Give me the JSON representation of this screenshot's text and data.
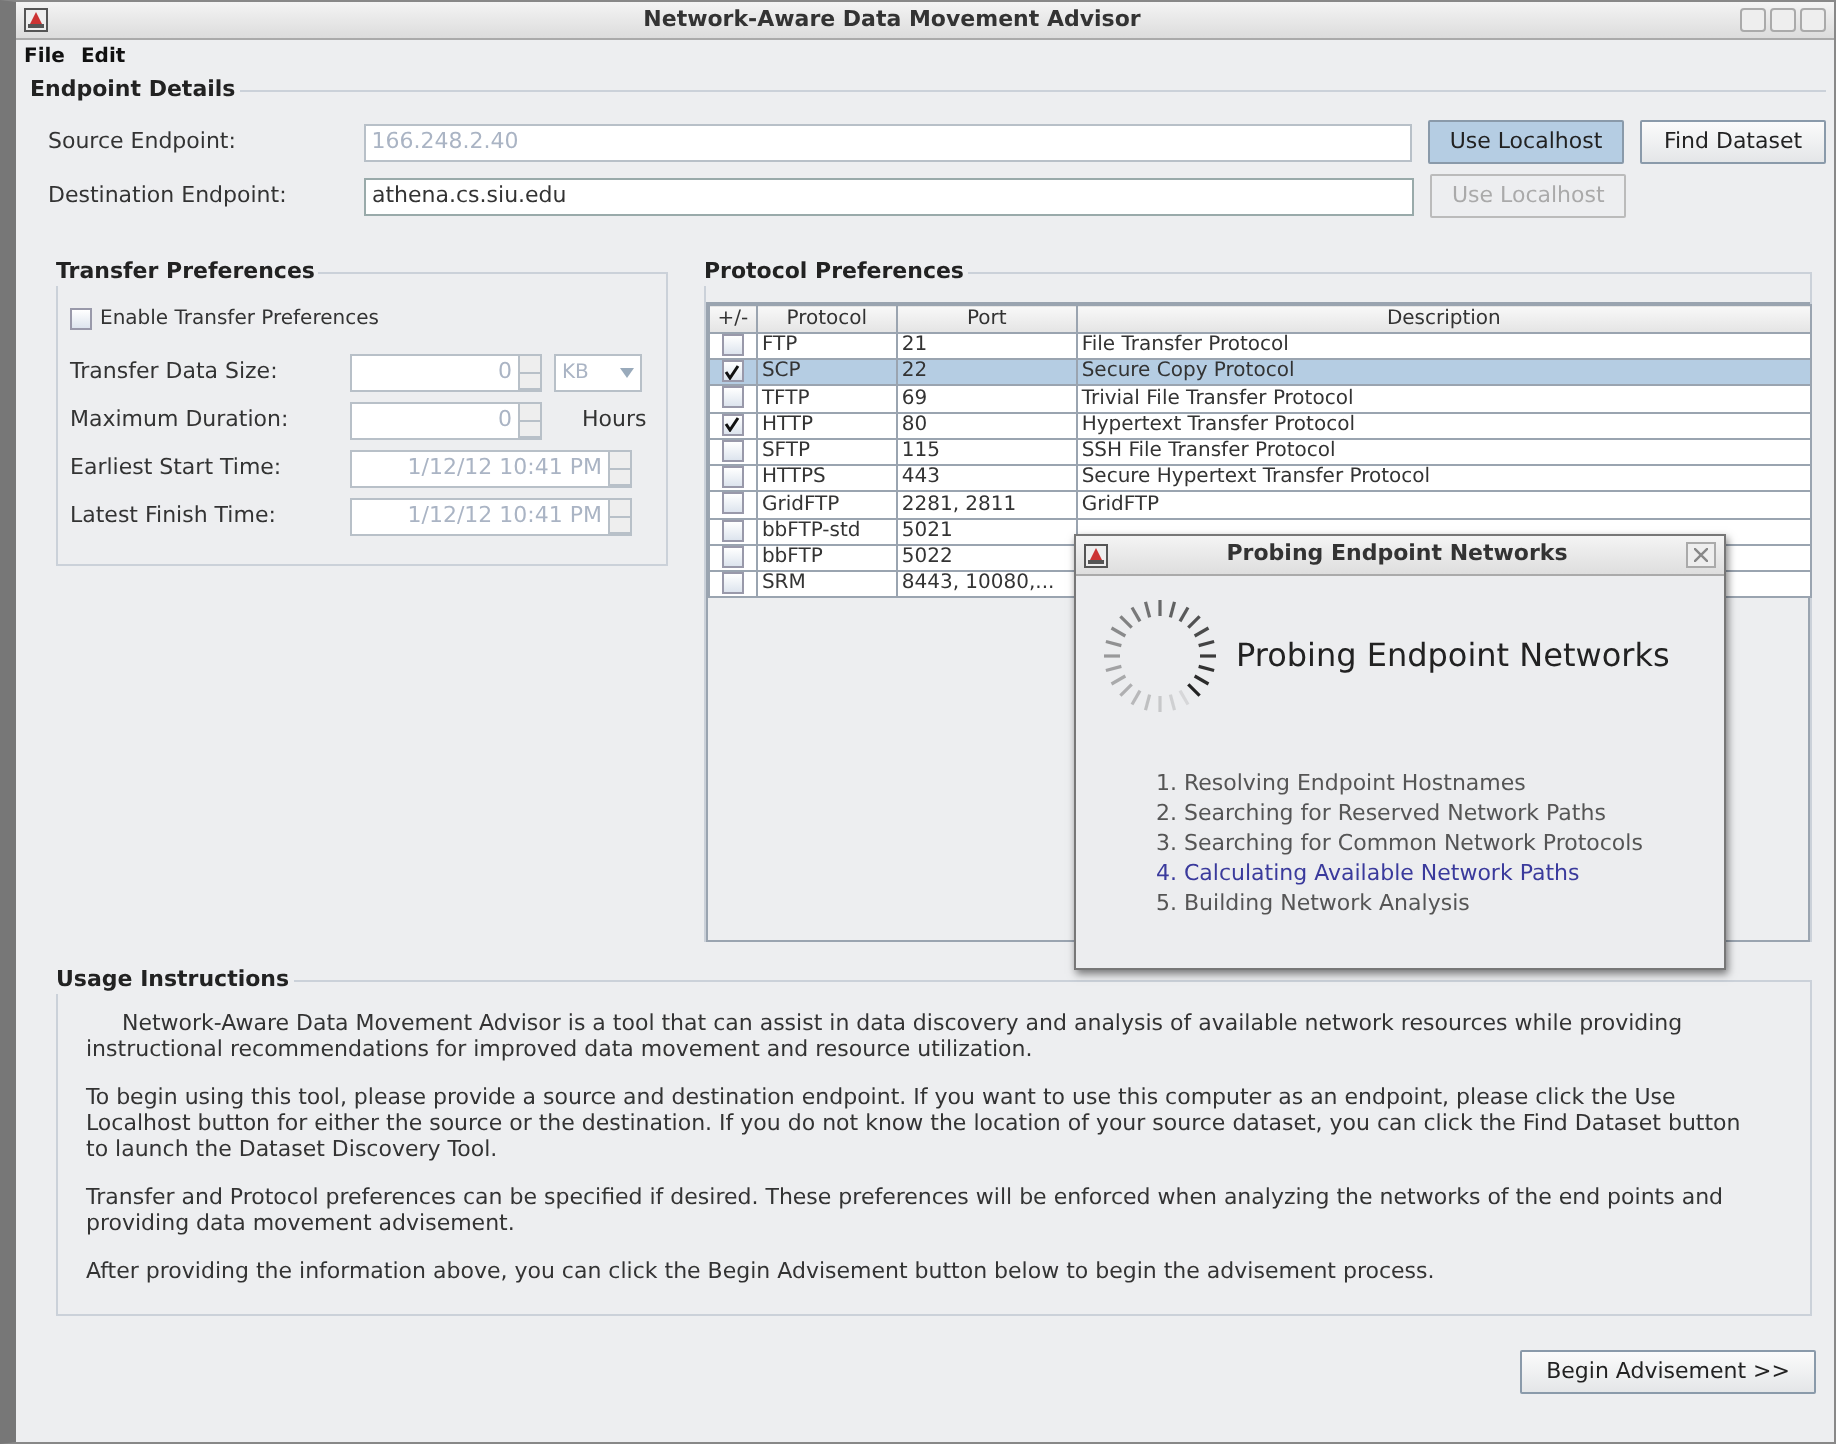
{
  "window": {
    "title": "Network-Aware Data Movement Advisor"
  },
  "menu": [
    "File",
    "Edit"
  ],
  "endpoint_details": {
    "title": "Endpoint Details",
    "rows": [
      {
        "label": "Source Endpoint:",
        "value": "166.248.2.40",
        "disabled": true,
        "buttons": [
          {
            "label": "Use Localhost",
            "selected": true,
            "disabled": false
          },
          {
            "label": "Find Dataset",
            "selected": false,
            "disabled": false
          }
        ]
      },
      {
        "label": "Destination Endpoint:",
        "value": "athena.cs.siu.edu",
        "disabled": false,
        "buttons": [
          {
            "label": "Use Localhost",
            "selected": false,
            "disabled": true
          }
        ]
      }
    ]
  },
  "transfer_preferences": {
    "title": "Transfer Preferences",
    "enable": {
      "label": "Enable Transfer Preferences",
      "checked": false
    },
    "fields": [
      {
        "kind": "number_unit",
        "label": "Transfer Data Size:",
        "value": "0",
        "unit": "KB"
      },
      {
        "kind": "number_suffix",
        "label": "Maximum Duration:",
        "value": "0",
        "suffix": "Hours"
      },
      {
        "kind": "datetime",
        "label": "Earliest Start Time:",
        "value": "1/12/12 10:41 PM"
      },
      {
        "kind": "datetime",
        "label": "Latest Finish Time:",
        "value": "1/12/12 10:41 PM"
      }
    ]
  },
  "protocol_preferences": {
    "title": "Protocol Preferences",
    "columns": [
      "+/-",
      "Protocol",
      "Port",
      "Description"
    ],
    "rows": [
      {
        "checked": false,
        "selected": false,
        "protocol": "FTP",
        "port": "21",
        "description": "File Transfer Protocol"
      },
      {
        "checked": true,
        "selected": true,
        "protocol": "SCP",
        "port": "22",
        "description": "Secure Copy Protocol"
      },
      {
        "checked": false,
        "selected": false,
        "protocol": "TFTP",
        "port": "69",
        "description": "Trivial File Transfer Protocol"
      },
      {
        "checked": true,
        "selected": false,
        "protocol": "HTTP",
        "port": "80",
        "description": "Hypertext Transfer Protocol"
      },
      {
        "checked": false,
        "selected": false,
        "protocol": "SFTP",
        "port": "115",
        "description": "SSH File Transfer Protocol"
      },
      {
        "checked": false,
        "selected": false,
        "protocol": "HTTPS",
        "port": "443",
        "description": "Secure Hypertext Transfer Protocol"
      },
      {
        "checked": false,
        "selected": false,
        "protocol": "GridFTP",
        "port": "2281, 2811",
        "description": "GridFTP"
      },
      {
        "checked": false,
        "selected": false,
        "protocol": "bbFTP-std",
        "port": "5021"
      },
      {
        "checked": false,
        "selected": false,
        "protocol": "bbFTP",
        "port": "5022"
      },
      {
        "checked": false,
        "selected": false,
        "protocol": "SRM",
        "port": "8443, 10080,..."
      }
    ]
  },
  "dialog": {
    "title": "Probing Endpoint Networks",
    "heading": "Probing Endpoint Networks",
    "steps": [
      {
        "text": "1. Resolving Endpoint Hostnames",
        "current": false
      },
      {
        "text": "2. Searching for Reserved Network Paths",
        "current": false
      },
      {
        "text": "3. Searching for Common Network Protocols",
        "current": false
      },
      {
        "text": "4. Calculating Available Network Paths",
        "current": true
      },
      {
        "text": "5. Building Network Analysis",
        "current": false
      }
    ]
  },
  "usage_instructions": {
    "title": "Usage Instructions",
    "paragraphs": [
      "Network-Aware Data Movement Advisor is a tool that can assist in data discovery and analysis of available network resources while providing instructional recommendations for improved data movement and resource utilization.",
      "To begin using this tool, please provide a source and destination endpoint. If you want to use this computer as an endpoint, please click the Use Localhost button for either the source or the destination. If you do not know the location of your source dataset, you can click the Find Dataset button to launch the Dataset Discovery Tool.",
      "Transfer and Protocol preferences can be specified if desired. These preferences will be enforced when analyzing the networks of the end points and providing data movement advisement.",
      "After providing the information above, you can click the Begin Advisement button below to begin the advisement process."
    ]
  },
  "begin_button": "Begin Advisement >>"
}
